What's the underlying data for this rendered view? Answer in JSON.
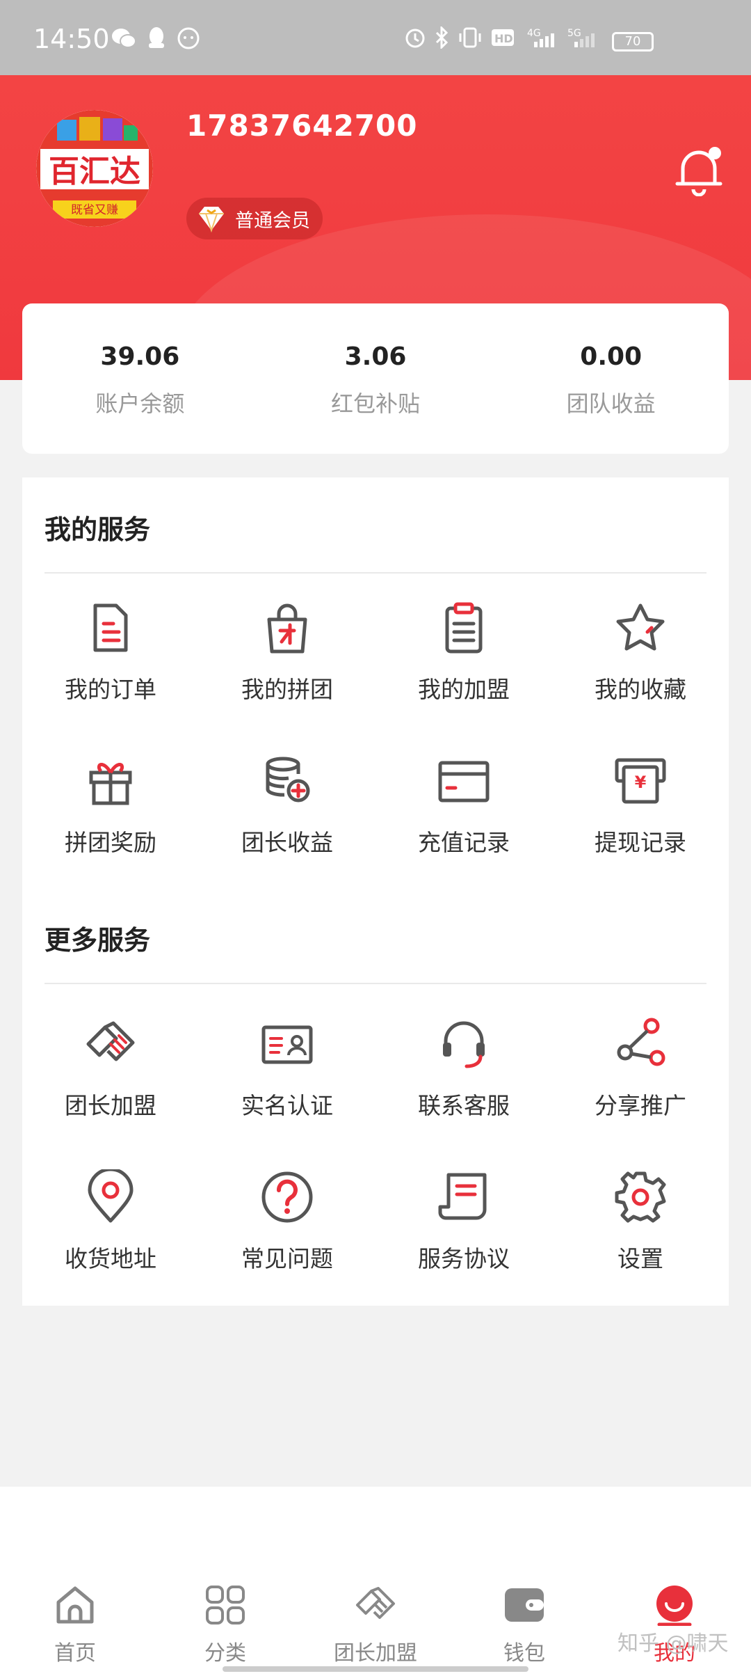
{
  "status_bar": {
    "time": "14:50",
    "battery": "70"
  },
  "profile": {
    "phone": "17837642700",
    "member_level": "普通会员",
    "avatar_text": "百汇达",
    "avatar_subtext": "既省又赚"
  },
  "stats": [
    {
      "value": "39.06",
      "label": "账户余额"
    },
    {
      "value": "3.06",
      "label": "红包补贴"
    },
    {
      "value": "0.00",
      "label": "团队收益"
    }
  ],
  "my_services": {
    "title": "我的服务",
    "items": [
      {
        "label": "我的订单",
        "icon": "order-doc-icon"
      },
      {
        "label": "我的拼团",
        "icon": "group-bag-icon"
      },
      {
        "label": "我的加盟",
        "icon": "clipboard-icon"
      },
      {
        "label": "我的收藏",
        "icon": "star-icon"
      },
      {
        "label": "拼团奖励",
        "icon": "gift-icon"
      },
      {
        "label": "团长收益",
        "icon": "coins-icon"
      },
      {
        "label": "充值记录",
        "icon": "card-icon"
      },
      {
        "label": "提现记录",
        "icon": "withdraw-icon"
      }
    ]
  },
  "more_services": {
    "title": "更多服务",
    "items": [
      {
        "label": "团长加盟",
        "icon": "handshake-icon"
      },
      {
        "label": "实名认证",
        "icon": "id-card-icon"
      },
      {
        "label": "联系客服",
        "icon": "headset-icon"
      },
      {
        "label": "分享推广",
        "icon": "share-icon"
      },
      {
        "label": "收货地址",
        "icon": "location-icon"
      },
      {
        "label": "常见问题",
        "icon": "question-icon"
      },
      {
        "label": "服务协议",
        "icon": "agreement-icon"
      },
      {
        "label": "设置",
        "icon": "gear-icon"
      }
    ]
  },
  "tabbar": [
    {
      "label": "首页",
      "icon": "home-icon"
    },
    {
      "label": "分类",
      "icon": "category-icon"
    },
    {
      "label": "团长加盟",
      "icon": "handshake-icon"
    },
    {
      "label": "钱包",
      "icon": "wallet-icon"
    },
    {
      "label": "我的",
      "icon": "profile-icon"
    }
  ],
  "watermark": "知乎 @啸天",
  "colors": {
    "accent": "#e8303b",
    "header": "#f34444",
    "icon_gray": "#555555"
  }
}
